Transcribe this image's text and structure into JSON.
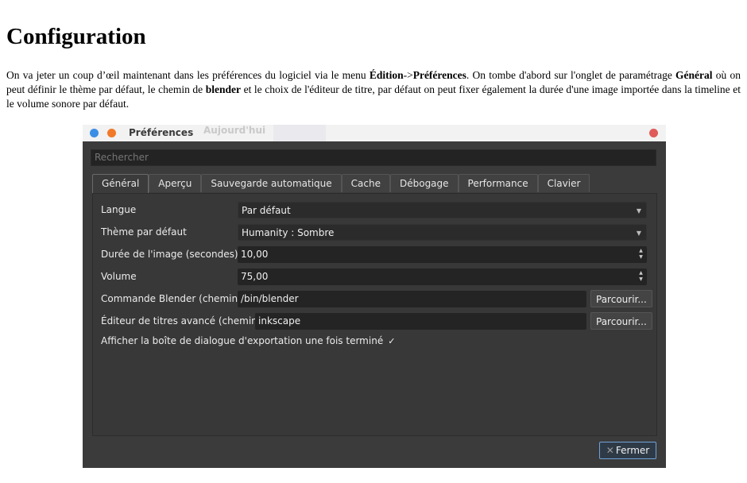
{
  "doc": {
    "title": "Configuration",
    "para_parts": [
      "On va jeter un coup d’œil maintenant dans les préférences du logiciel via le menu ",
      "Édition",
      "->",
      "Préférences",
      ". On tombe d'abord sur l'onglet de paramétrage ",
      "Général",
      " où on peut définir le thème par défaut, le chemin de ",
      "blender",
      " et le choix de l'éditeur de titre, par défaut on peut fixer également la durée d'une image importée dans la timeline et le volume sonore par défaut."
    ]
  },
  "window": {
    "title": "Préférences",
    "ghost_text": "Aujourd'hui",
    "colors": {
      "dot_blue": "#3b8ee5",
      "dot_orange": "#f07a2a",
      "close": "#e05a5a",
      "accent": "#6fa3d8"
    },
    "search_placeholder": "Rechercher",
    "tabs": [
      "Général",
      "Aperçu",
      "Sauvegarde automatique",
      "Cache",
      "Débogage",
      "Performance",
      "Clavier"
    ],
    "active_tab": "Général",
    "settings": {
      "language_label": "Langue",
      "language_value": "Par défaut",
      "theme_label": "Thème par défaut",
      "theme_value": "Humanity : Sombre",
      "duration_label": "Durée de l'image (secondes)",
      "duration_value": "10,00",
      "volume_label": "Volume",
      "volume_value": "75,00",
      "blender_label": "Commande Blender (chemin)",
      "blender_value": "/bin/blender",
      "editor_label": "Éditeur de titres avancé (chemin)",
      "editor_value": "inkscape",
      "browse_label": "Parcourir...",
      "export_dialog_label": "Afficher la boîte de dialogue d'exportation une fois terminé",
      "export_dialog_checked": "✓"
    },
    "close_label": "Fermer",
    "close_icon": "x-icon"
  }
}
